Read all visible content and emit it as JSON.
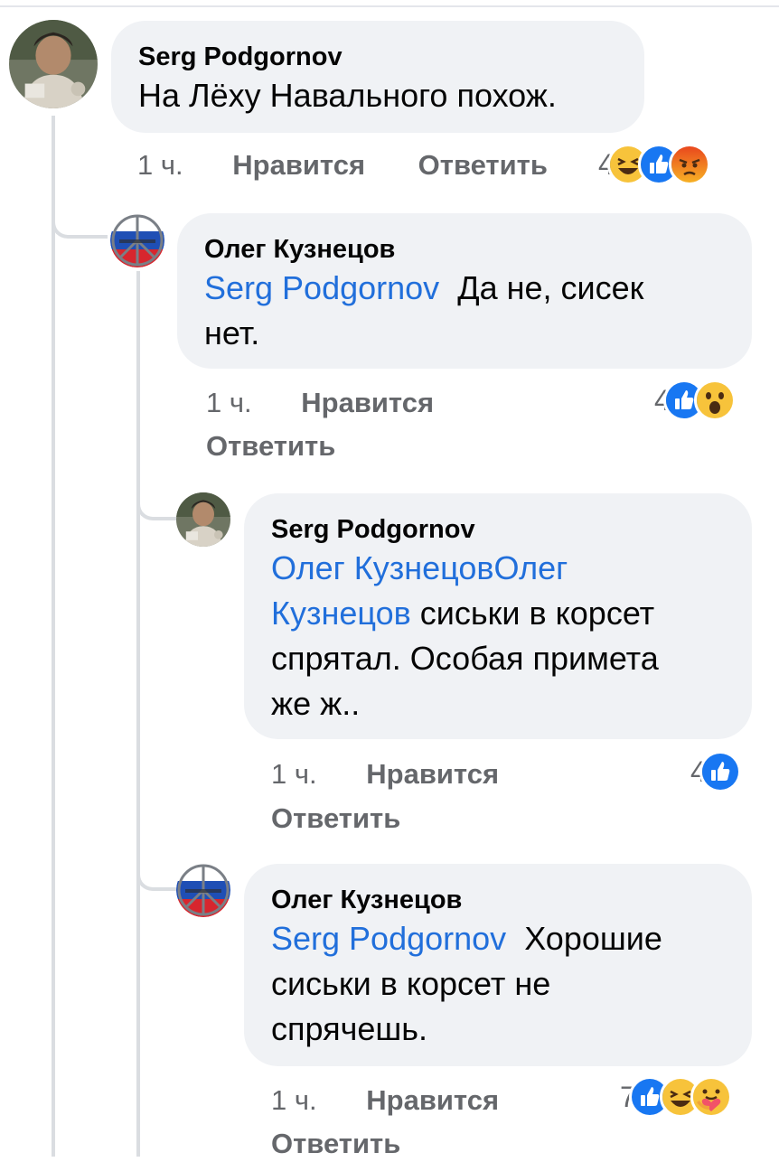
{
  "comments": [
    {
      "author": "Serg Podgornov",
      "mention": "",
      "text": "На Лёху Навального похож.",
      "time": "1 ч.",
      "like_label": "Нравится",
      "reply_label": "Ответить",
      "reaction_count": "4",
      "reactions": [
        "laugh-reaction-icon",
        "like-reaction-icon",
        "angry-reaction-icon"
      ]
    },
    {
      "author": "Олег Кузнецов",
      "mention": "Serg Podgornov",
      "text_line1": "Да не, сисек",
      "text_line2": "нет.",
      "time": "1 ч.",
      "like_label": "Нравится",
      "reply_label": "Ответить",
      "reaction_count": "4",
      "reactions": [
        "like-reaction-icon",
        "wow-reaction-icon"
      ]
    },
    {
      "author": "Serg Podgornov",
      "mention_line1": "Олег КузнецовОлег",
      "mention_line2": "Кузнецов",
      "text_line2": "сиськи в корсет",
      "text_line3": "спрятал. Особая примета",
      "text_line4": "же ж..",
      "time": "1 ч.",
      "like_label": "Нравится",
      "reply_label": "Ответить",
      "reaction_count": "4",
      "reactions": [
        "like-reaction-icon"
      ]
    },
    {
      "author": "Олег Кузнецов",
      "mention": "Serg Podgornov",
      "text_line1": "Хорошие",
      "text_line2": "сиськи в корсет не",
      "text_line3": "спрячешь.",
      "time": "1 ч.",
      "like_label": "Нравится",
      "reply_label": "Ответить",
      "reaction_count": "7",
      "reactions": [
        "like-reaction-icon",
        "laugh-reaction-icon",
        "care-reaction-icon"
      ]
    }
  ],
  "colors": {
    "bubble": "#f0f2f5",
    "mention": "#216fdb",
    "meta": "#65676b",
    "like_blue": "#1877f2"
  }
}
